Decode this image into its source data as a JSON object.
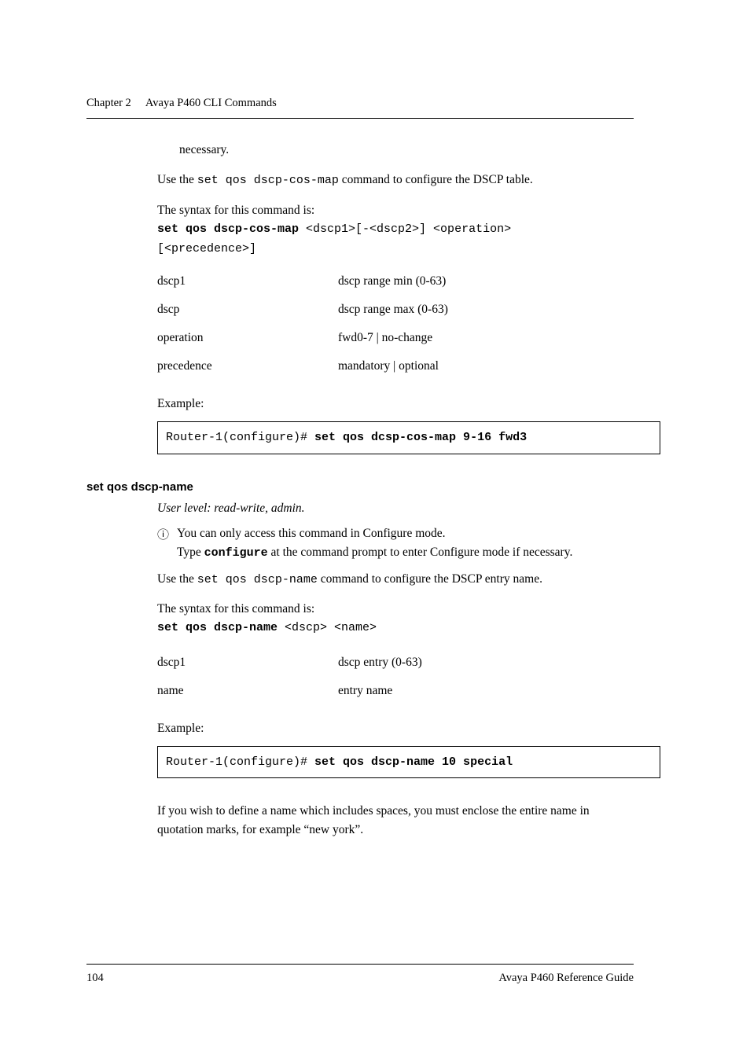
{
  "runningHead": {
    "chapter": "Chapter 2",
    "title": "Avaya P460 CLI Commands"
  },
  "section1": {
    "noteTail": "necessary.",
    "intro1a": "Use the ",
    "introCmd": "set qos dscp-cos-map",
    "intro1b": " command to configure the DSCP table.",
    "syntaxLead": "The syntax for this command is:",
    "syntaxCmdBold": "set qos dscp-cos-map",
    "syntaxCmdRest": " <dscp1>[-<dscp2>] <operation>",
    "syntaxLine2": "[<precedence>]",
    "params": [
      {
        "name": "dscp1",
        "desc": "dscp range min (0-63)"
      },
      {
        "name": "dscp",
        "desc": "dscp range max (0-63)"
      },
      {
        "name": "operation",
        "desc": "fwd0-7 | no-change"
      },
      {
        "name": "precedence",
        "desc": "mandatory | optional"
      }
    ],
    "exampleLabel": "Example:",
    "exampleCodePlain": "Router-1(configure)# ",
    "exampleCodeBold": "set qos dcsp-cos-map 9-16 fwd3"
  },
  "section2": {
    "heading": "set qos dscp-name",
    "userLevel": "User level: read-write, admin.",
    "noteLine1": "You can only access this command in Configure mode.",
    "noteLine2a": "Type ",
    "noteLine2Cmd": "configure",
    "noteLine2b": " at the command prompt to enter Configure mode if necessary.",
    "intro1a": "Use the ",
    "introCmd": "set qos dscp-name",
    "intro1b": " command to configure the DSCP entry name.",
    "syntaxLead": "The syntax for this command is:",
    "syntaxCmdBold": "set qos dscp-name",
    "syntaxCmdRest": " <dscp> <name>",
    "params": [
      {
        "name": "dscp1",
        "desc": "dscp entry (0-63)"
      },
      {
        "name": "name",
        "desc": "entry name"
      }
    ],
    "exampleLabel": "Example:",
    "exampleCodePlain": "Router-1(configure)#  ",
    "exampleCodeBold": "set qos dscp-name 10 special",
    "tailPara": "If you wish to define a name which includes spaces, you must enclose the entire name in quotation marks, for example “new york”."
  },
  "footer": {
    "pageNum": "104",
    "docTitle": "Avaya P460 Reference Guide"
  }
}
